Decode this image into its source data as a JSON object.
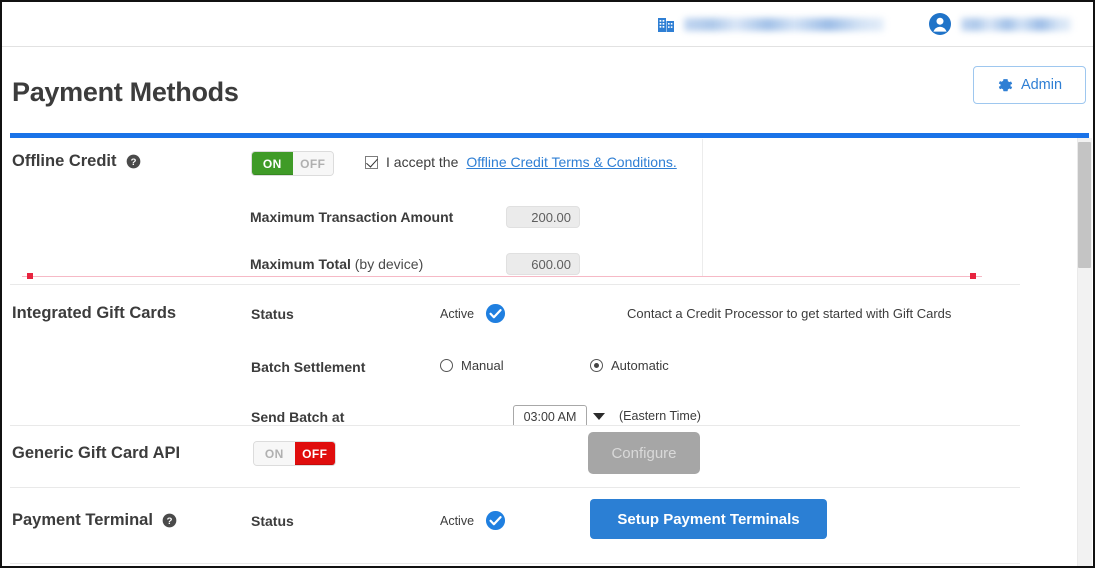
{
  "topbar": {
    "company_icon": "building-icon",
    "company_name_redacted": "██████ ████████",
    "user_icon": "avatar-icon",
    "user_name_redacted": "███ █████"
  },
  "header": {
    "title": "Payment Methods",
    "admin_label": "Admin",
    "admin_icon": "gear-icon"
  },
  "colors": {
    "accent_blue": "#1a73e8",
    "link_blue": "#2f7fd4",
    "toggle_on_green": "#3f9b27",
    "toggle_off_red": "#e00d0d",
    "primary_button": "#2b7fd4",
    "disabled_button": "#a6a6a6",
    "annotation_red": "#e8243f"
  },
  "sections": {
    "offline_credit": {
      "label": "Offline Credit",
      "help_icon": "help-icon",
      "toggle": {
        "on_label": "ON",
        "off_label": "OFF",
        "state": "ON"
      },
      "accept": {
        "checked": true,
        "prefix": "I accept the",
        "link_text": "Offline Credit Terms & Conditions."
      },
      "fields": [
        {
          "label": "Maximum Transaction Amount",
          "value": "200.00"
        },
        {
          "label": "Maximum Total",
          "label_suffix": "(by device)",
          "value": "600.00"
        }
      ]
    },
    "integrated_gift_cards": {
      "label": "Integrated Gift Cards",
      "status_label": "Status",
      "status_value": "Active",
      "status_icon": "check-circle-icon",
      "hint": "Contact a Credit Processor to get started with Gift Cards",
      "batch_label": "Batch Settlement",
      "batch_options": [
        {
          "label": "Manual",
          "selected": false
        },
        {
          "label": "Automatic",
          "selected": true
        }
      ],
      "send_batch_label": "Send Batch at",
      "send_batch_time": "03:00 AM",
      "send_batch_caret": "chevron-down-icon",
      "timezone": "(Eastern Time)"
    },
    "generic_gift_card_api": {
      "label": "Generic Gift Card API",
      "toggle": {
        "on_label": "ON",
        "off_label": "OFF",
        "state": "OFF"
      },
      "configure_label": "Configure",
      "configure_disabled": true
    },
    "payment_terminal": {
      "label": "Payment Terminal",
      "help_icon": "help-icon",
      "status_label": "Status",
      "status_value": "Active",
      "status_icon": "check-circle-icon",
      "setup_label": "Setup Payment Terminals"
    }
  }
}
